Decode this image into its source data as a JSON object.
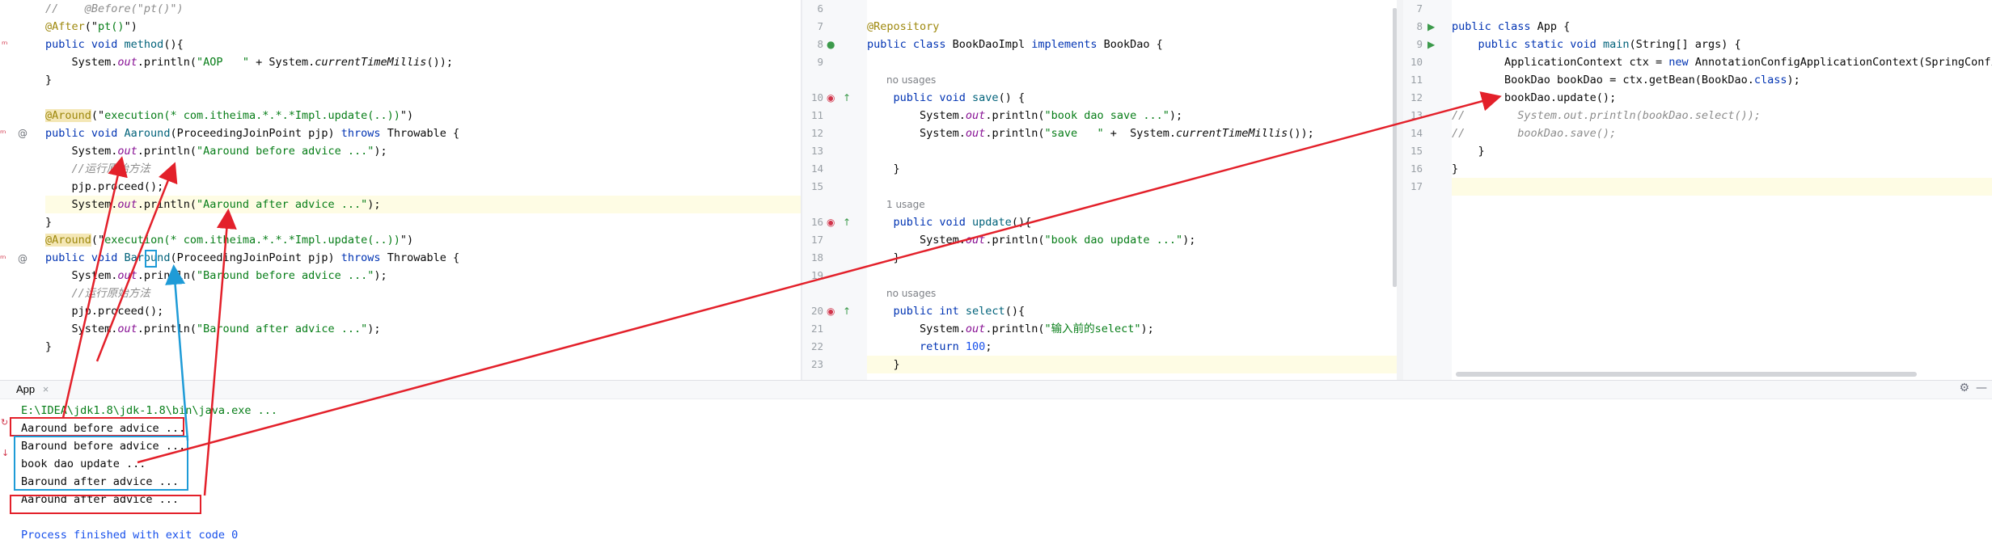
{
  "left_pane": {
    "lines": [
      {
        "parts": [
          [
            "cmt",
            "//    @Before(\"pt()\")"
          ]
        ]
      },
      {
        "parts": [
          [
            "ann",
            "@After"
          ],
          [
            "",
            "(\""
          ],
          [
            "str",
            "pt()"
          ],
          [
            "",
            "\")"
          ]
        ]
      },
      {
        "parts": [
          [
            "kw",
            "public void "
          ],
          [
            "m",
            "method"
          ],
          [
            "",
            "(){"
          ]
        ]
      },
      {
        "parts": [
          [
            "",
            "    System."
          ],
          [
            "fld",
            "out"
          ],
          [
            "",
            ".println("
          ],
          [
            "str",
            "\"AOP   \""
          ],
          [
            "",
            " + System."
          ],
          [
            "ital",
            "currentTimeMillis"
          ],
          [
            "",
            "());"
          ]
        ]
      },
      {
        "parts": [
          [
            "",
            "}"
          ]
        ]
      },
      {
        "parts": [
          [
            "",
            ""
          ]
        ]
      },
      {
        "parts": [
          [
            "ann annbg",
            "@Around"
          ],
          [
            "",
            "(\""
          ],
          [
            "str",
            "execution(* com.itheima.*.*.*Impl.update(..))"
          ],
          [
            "",
            "\")"
          ]
        ]
      },
      {
        "parts": [
          [
            "kw",
            "public void "
          ],
          [
            "m",
            "Aaround"
          ],
          [
            "",
            "(ProceedingJoinPoint pjp) "
          ],
          [
            "kw",
            "throws "
          ],
          [
            "",
            "Throwable {"
          ]
        ]
      },
      {
        "parts": [
          [
            "",
            "    System."
          ],
          [
            "fld",
            "out"
          ],
          [
            "",
            ".println("
          ],
          [
            "str",
            "\"Aaround before advice ...\""
          ],
          [
            "",
            ");"
          ]
        ]
      },
      {
        "parts": [
          [
            "cmt",
            "    //运行原始方法"
          ]
        ]
      },
      {
        "parts": [
          [
            "",
            "    pjp.proceed();"
          ]
        ]
      },
      {
        "parts": [
          [
            "",
            "    System."
          ],
          [
            "fld",
            "out"
          ],
          [
            "",
            ".println("
          ],
          [
            "str",
            "\"Aaround after advice ...\""
          ],
          [
            "",
            ");"
          ]
        ],
        "hl": true
      },
      {
        "parts": [
          [
            "",
            "}"
          ]
        ]
      },
      {
        "parts": [
          [
            "ann annbg",
            "@Around"
          ],
          [
            "",
            "(\""
          ],
          [
            "str",
            "execution(* com.itheima.*.*.*Impl.update(..))"
          ],
          [
            "",
            "\")"
          ]
        ]
      },
      {
        "parts": [
          [
            "kw",
            "public void "
          ],
          [
            "m",
            "Baround"
          ],
          [
            "",
            "(ProceedingJoinPoint pjp) "
          ],
          [
            "kw",
            "throws "
          ],
          [
            "",
            "Throwable {"
          ]
        ]
      },
      {
        "parts": [
          [
            "",
            "    System."
          ],
          [
            "fld",
            "out"
          ],
          [
            "",
            ".println("
          ],
          [
            "str",
            "\"Baround before advice ...\""
          ],
          [
            "",
            ");"
          ]
        ]
      },
      {
        "parts": [
          [
            "cmt",
            "    //运行原始方法"
          ]
        ]
      },
      {
        "parts": [
          [
            "",
            "    pjp.proceed();"
          ]
        ]
      },
      {
        "parts": [
          [
            "",
            "    System."
          ],
          [
            "fld",
            "out"
          ],
          [
            "",
            ".println("
          ],
          [
            "str",
            "\"Baround after advice ...\""
          ],
          [
            "",
            ");"
          ]
        ]
      },
      {
        "parts": [
          [
            "",
            "}"
          ]
        ]
      }
    ]
  },
  "middle_pane": {
    "lines": [
      {
        "n": "6",
        "parts": [
          [
            "",
            ""
          ]
        ]
      },
      {
        "n": "7",
        "parts": [
          [
            "ann",
            "@Repository"
          ]
        ]
      },
      {
        "n": "8",
        "parts": [
          [
            "kw",
            "public class "
          ],
          [
            "",
            "BookDaoImpl "
          ],
          [
            "kw",
            "implements "
          ],
          [
            "",
            "BookDao {"
          ]
        ]
      },
      {
        "n": "9",
        "parts": [
          [
            "",
            ""
          ]
        ]
      },
      {
        "n": "",
        "hint": "no usages"
      },
      {
        "n": "10",
        "parts": [
          [
            "kw",
            "    public void "
          ],
          [
            "m",
            "save"
          ],
          [
            "",
            "() {"
          ]
        ]
      },
      {
        "n": "11",
        "parts": [
          [
            "",
            "        System."
          ],
          [
            "fld",
            "out"
          ],
          [
            "",
            ".println("
          ],
          [
            "str",
            "\"book dao save ...\""
          ],
          [
            "",
            ");"
          ]
        ]
      },
      {
        "n": "12",
        "parts": [
          [
            "",
            "        System."
          ],
          [
            "fld",
            "out"
          ],
          [
            "",
            ".println("
          ],
          [
            "str",
            "\"save   \""
          ],
          [
            "",
            " +  System."
          ],
          [
            "ital",
            "currentTimeMillis"
          ],
          [
            "",
            "());"
          ]
        ]
      },
      {
        "n": "13",
        "parts": [
          [
            "",
            ""
          ]
        ]
      },
      {
        "n": "14",
        "parts": [
          [
            "",
            "    }"
          ]
        ]
      },
      {
        "n": "15",
        "parts": [
          [
            "",
            ""
          ]
        ]
      },
      {
        "n": "",
        "hint": "1 usage"
      },
      {
        "n": "16",
        "parts": [
          [
            "kw",
            "    public void "
          ],
          [
            "m",
            "update"
          ],
          [
            "",
            "(){"
          ]
        ]
      },
      {
        "n": "17",
        "parts": [
          [
            "",
            "        System."
          ],
          [
            "fld",
            "out"
          ],
          [
            "",
            ".println("
          ],
          [
            "str",
            "\"book dao update ...\""
          ],
          [
            "",
            ");"
          ]
        ]
      },
      {
        "n": "18",
        "parts": [
          [
            "",
            "    }"
          ]
        ]
      },
      {
        "n": "19",
        "parts": [
          [
            "",
            ""
          ]
        ]
      },
      {
        "n": "",
        "hint": "no usages"
      },
      {
        "n": "20",
        "parts": [
          [
            "kw",
            "    public int "
          ],
          [
            "m",
            "select"
          ],
          [
            "",
            "(){"
          ]
        ]
      },
      {
        "n": "21",
        "parts": [
          [
            "",
            "        System."
          ],
          [
            "fld",
            "out"
          ],
          [
            "",
            ".println("
          ],
          [
            "str",
            "\"输入前的select\""
          ],
          [
            "",
            ");"
          ]
        ]
      },
      {
        "n": "22",
        "parts": [
          [
            "kw",
            "        return "
          ],
          [
            "num",
            "100"
          ],
          [
            "",
            ";"
          ]
        ]
      },
      {
        "n": "23",
        "parts": [
          [
            "",
            "    }"
          ]
        ],
        "hl": true
      }
    ]
  },
  "right_pane": {
    "lines": [
      {
        "n": "7",
        "parts": [
          [
            "",
            ""
          ]
        ]
      },
      {
        "n": "8",
        "parts": [
          [
            "kw",
            "public class "
          ],
          [
            "",
            "App {"
          ]
        ]
      },
      {
        "n": "9",
        "parts": [
          [
            "kw",
            "    public static void "
          ],
          [
            "m",
            "main"
          ],
          [
            "",
            "(String[] args) {"
          ]
        ]
      },
      {
        "n": "10",
        "parts": [
          [
            "",
            "        ApplicationContext ctx = "
          ],
          [
            "kw",
            "new "
          ],
          [
            "",
            "AnnotationConfigApplicationContext(SpringConfig."
          ],
          [
            "kw",
            "class"
          ],
          [
            "",
            ");"
          ]
        ]
      },
      {
        "n": "11",
        "parts": [
          [
            "",
            "        BookDao bookDao = ctx.getBean(BookDao."
          ],
          [
            "kw",
            "class"
          ],
          [
            "",
            ");"
          ]
        ]
      },
      {
        "n": "12",
        "parts": [
          [
            "",
            "        bookDao.update();"
          ]
        ]
      },
      {
        "n": "13",
        "parts": [
          [
            "cmt",
            "//        System.out.println(bookDao.select());"
          ]
        ]
      },
      {
        "n": "14",
        "parts": [
          [
            "cmt",
            "//        bookDao.save();"
          ]
        ]
      },
      {
        "n": "15",
        "parts": [
          [
            "",
            "    }"
          ]
        ]
      },
      {
        "n": "16",
        "parts": [
          [
            "",
            "}"
          ]
        ]
      },
      {
        "n": "17",
        "parts": [
          [
            "",
            ""
          ]
        ],
        "hl": true
      }
    ]
  },
  "console": {
    "tab_label": "App",
    "lines": [
      "E:\\IDEA\\jdk1.8\\jdk-1.8\\bin\\java.exe ...",
      "Aaround before advice ...",
      "Baround before advice ...",
      "book dao update ...",
      "Baround after advice ...",
      "Aaround after advice ...",
      "",
      "Process finished with exit code 0"
    ]
  },
  "colors": {
    "red_annotation": "#e3202a",
    "blue_annotation": "#1e9bd7",
    "keyword": "#0033b3",
    "string": "#067d17",
    "annotation": "#9e880d"
  }
}
